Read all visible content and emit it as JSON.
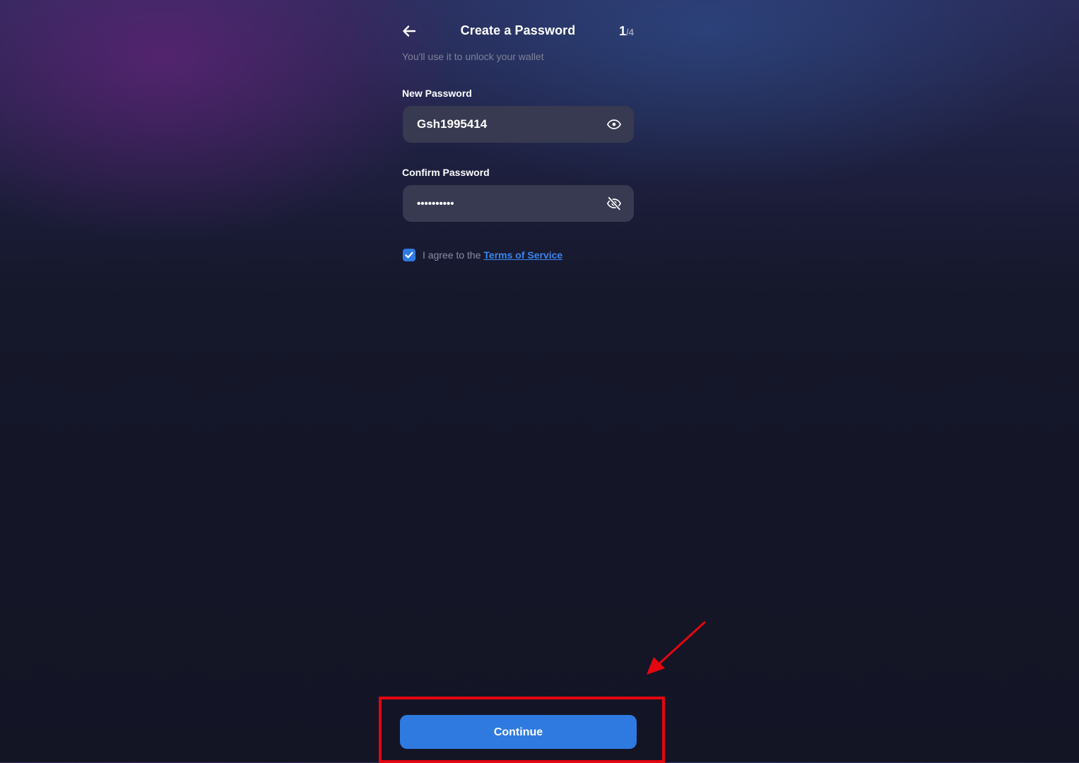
{
  "header": {
    "title": "Create a Password",
    "step_current": "1",
    "step_total": "/4"
  },
  "subtitle": "You'll use it to unlock your wallet",
  "new_password": {
    "label": "New Password",
    "value": "Gsh1995414",
    "visibility_icon": "eye-icon"
  },
  "confirm_password": {
    "label": "Confirm Password",
    "value": "Gsh1995414",
    "visibility_icon": "eye-off-icon"
  },
  "agreement": {
    "checked": true,
    "text": "I agree to the ",
    "link_text": "Terms of Service"
  },
  "continue_label": "Continue",
  "annotation": {
    "color": "#e5060f"
  },
  "colors": {
    "accent": "#2f7ae0",
    "field_bg": "#373a50",
    "page_bg": "#131525"
  }
}
